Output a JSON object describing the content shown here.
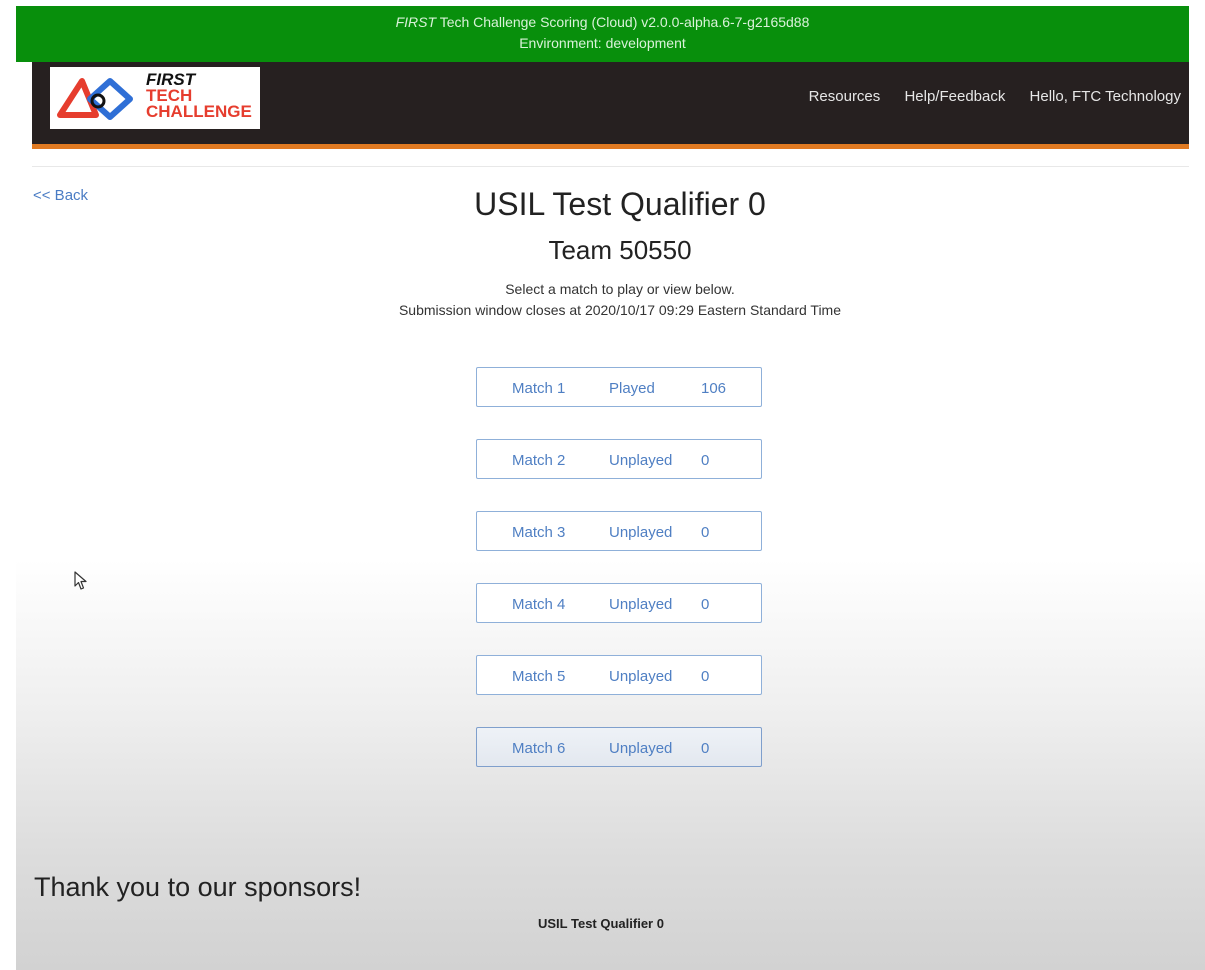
{
  "env_bar": {
    "first_word": "FIRST",
    "title_rest": " Tech Challenge Scoring (Cloud) v2.0.0-alpha.6-7-g2165d88",
    "environment": "Environment: development"
  },
  "logo": {
    "line1": "FIRST",
    "line2": "TECH",
    "line3": "CHALLENGE"
  },
  "nav": {
    "resources": "Resources",
    "help": "Help/Feedback",
    "user": "Hello, FTC Technology"
  },
  "back_label": "<< Back",
  "event_name": "USIL Test Qualifier 0",
  "team_label": "Team 50550",
  "instructions": {
    "line1": "Select a match to play or view below.",
    "line2": "Submission window closes at 2020/10/17 09:29 Eastern Standard Time"
  },
  "matches": [
    {
      "name": "Match 1",
      "status": "Played",
      "score": "106"
    },
    {
      "name": "Match 2",
      "status": "Unplayed",
      "score": "0"
    },
    {
      "name": "Match 3",
      "status": "Unplayed",
      "score": "0"
    },
    {
      "name": "Match 4",
      "status": "Unplayed",
      "score": "0"
    },
    {
      "name": "Match 5",
      "status": "Unplayed",
      "score": "0"
    },
    {
      "name": "Match 6",
      "status": "Unplayed",
      "score": "0"
    }
  ],
  "footer": {
    "sponsors": "Thank you to our sponsors!",
    "event_name": "USIL Test Qualifier 0"
  },
  "colors": {
    "env_bar": "#088f0c",
    "navbar": "#262020",
    "accent": "#e07a22",
    "link": "#4a7cc4"
  },
  "icons": {
    "logo": "ftc-logo-icon",
    "cursor": "mouse-pointer-icon"
  }
}
